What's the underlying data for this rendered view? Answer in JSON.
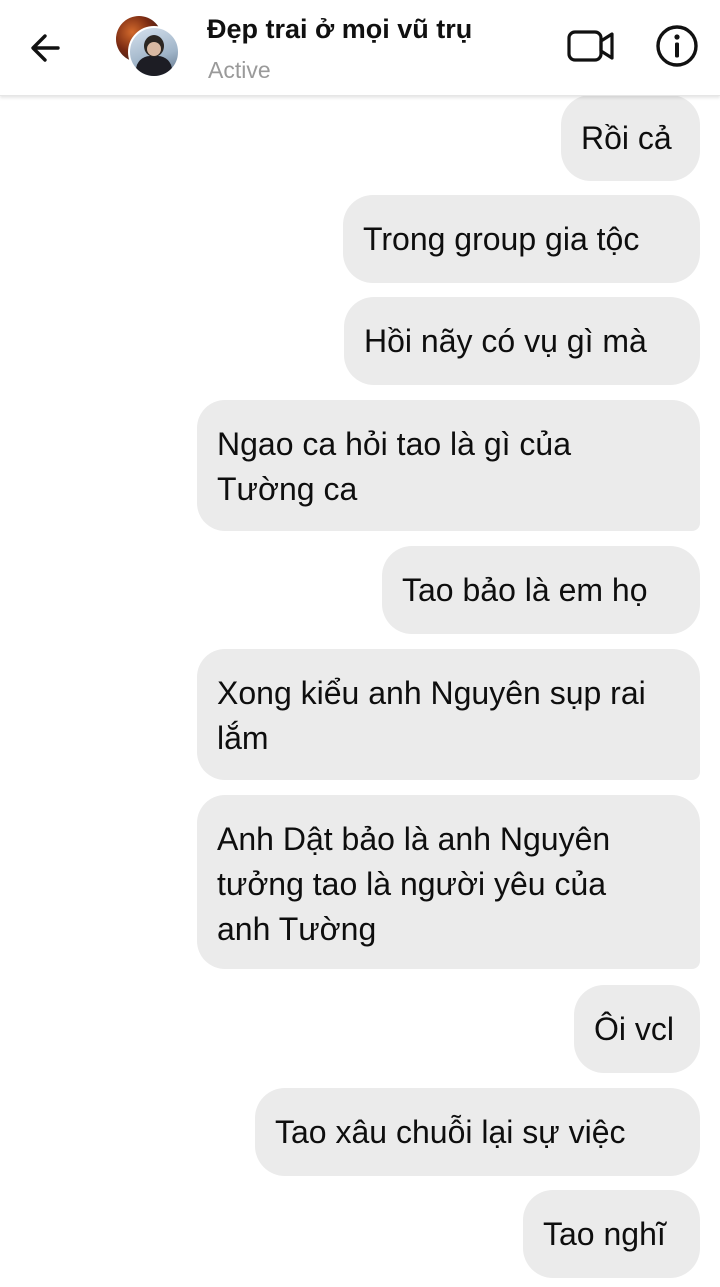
{
  "header": {
    "contact_name": "Đẹp trai ở mọi vũ trụ",
    "status": "Active",
    "icons": {
      "back": "arrow-left-icon",
      "video": "video-camera-icon",
      "info": "info-circle-icon"
    }
  },
  "messages": [
    {
      "sender": "me",
      "text": "Rồi cả"
    },
    {
      "sender": "me",
      "text": "Trong group gia tộc"
    },
    {
      "sender": "me",
      "text": "Hồi nãy có vụ gì mà"
    },
    {
      "sender": "me",
      "text": "Ngao ca hỏi tao là gì của Tường ca"
    },
    {
      "sender": "me",
      "text": "Tao bảo là em họ"
    },
    {
      "sender": "me",
      "text": "Xong kiểu anh Nguyên sụp rai lắm"
    },
    {
      "sender": "me",
      "text": "Anh Dật bảo là anh Nguyên tưởng tao là người yêu của anh Tường"
    },
    {
      "sender": "me",
      "text": "Ôi vcl"
    },
    {
      "sender": "me",
      "text": "Tao xâu chuỗi lại sự việc"
    },
    {
      "sender": "me",
      "text": "Tao nghĩ"
    }
  ],
  "colors": {
    "bubble": "#ebebeb",
    "text": "#0e0e0e",
    "status": "#9a9a9a",
    "background": "#ffffff"
  }
}
